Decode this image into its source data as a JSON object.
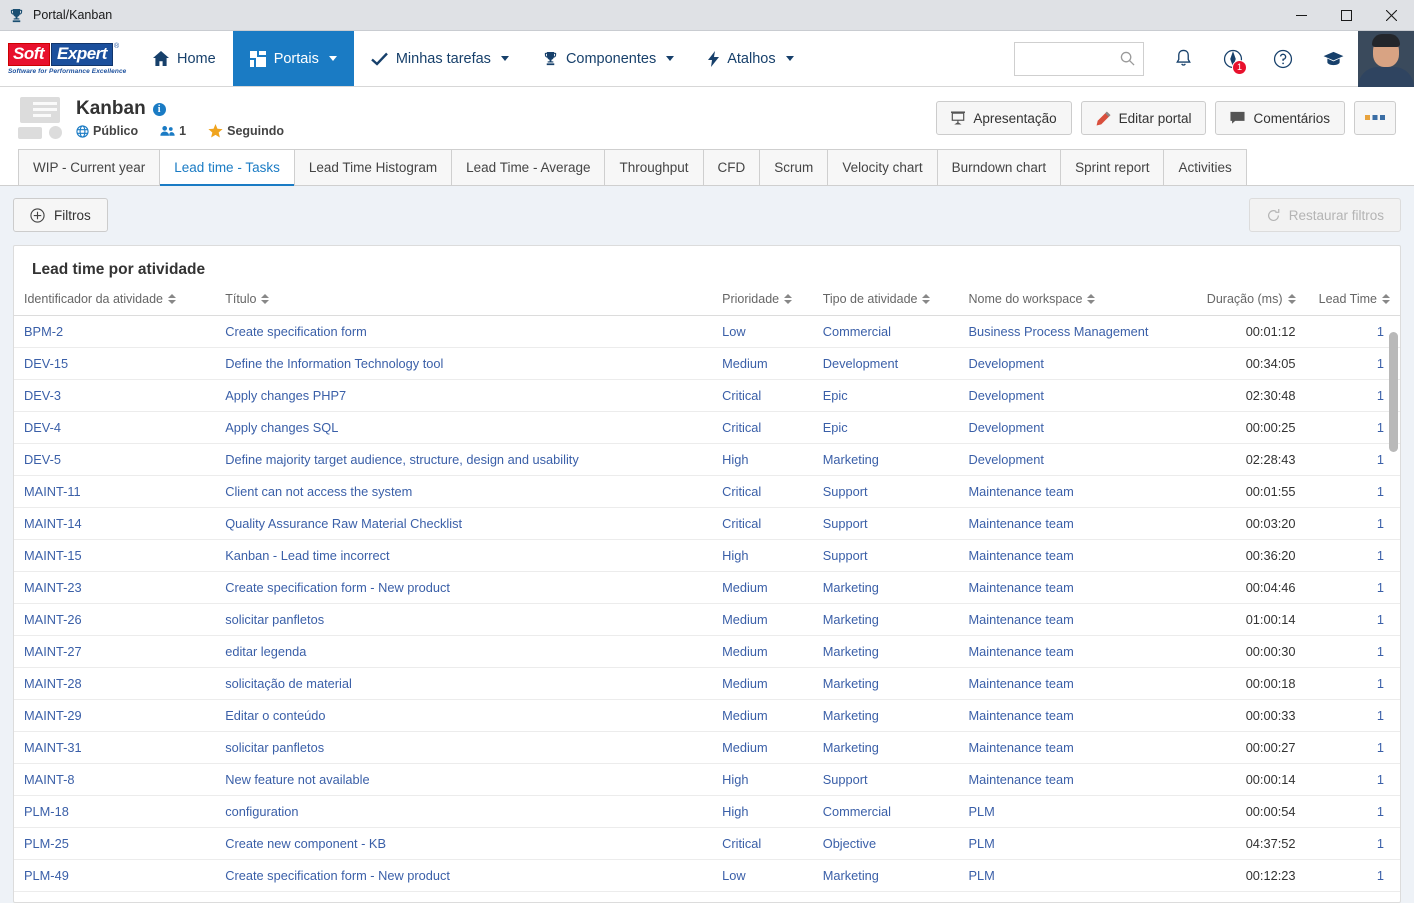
{
  "window": {
    "title": "Portal/Kanban",
    "icon": "trophy-icon",
    "minimize": "–",
    "maximize": "□",
    "close": "✕"
  },
  "brand": {
    "soft": "Soft",
    "expert": "Expert",
    "registered": "®",
    "tagline": "Software for Performance Excellence"
  },
  "nav": {
    "items": [
      {
        "label": "Home",
        "icon": "home-icon",
        "caret": false,
        "active": false
      },
      {
        "label": "Portais",
        "icon": "grid-icon",
        "caret": true,
        "active": true
      },
      {
        "label": "Minhas tarefas",
        "icon": "check-icon",
        "caret": true,
        "active": false
      },
      {
        "label": "Componentes",
        "icon": "trophy-icon",
        "caret": true,
        "active": false
      },
      {
        "label": "Atalhos",
        "icon": "bolt-icon",
        "caret": true,
        "active": false
      }
    ],
    "search": {
      "value": "",
      "placeholder": ""
    },
    "icons": [
      {
        "name": "bell-icon",
        "badge": ""
      },
      {
        "name": "compass-icon",
        "badge": "1"
      },
      {
        "name": "help-icon",
        "badge": ""
      },
      {
        "name": "graduation-icon",
        "badge": ""
      }
    ]
  },
  "header": {
    "title": "Kanban",
    "info_icon": "i",
    "visibility": "Público",
    "members_count": "1",
    "follow_label": "Seguindo",
    "buttons": [
      {
        "label": "Apresentação",
        "icon": "presentation-icon"
      },
      {
        "label": "Editar portal",
        "icon": "pencil-icon"
      },
      {
        "label": "Comentários",
        "icon": "comment-icon"
      },
      {
        "label": "···",
        "icon": "more-icon"
      }
    ]
  },
  "tabs": [
    {
      "label": "WIP - Current year",
      "active": false
    },
    {
      "label": "Lead time - Tasks",
      "active": true
    },
    {
      "label": "Lead Time Histogram",
      "active": false
    },
    {
      "label": "Lead Time - Average",
      "active": false
    },
    {
      "label": "Throughput",
      "active": false
    },
    {
      "label": "CFD",
      "active": false
    },
    {
      "label": "Scrum",
      "active": false
    },
    {
      "label": "Velocity chart",
      "active": false
    },
    {
      "label": "Burndown chart",
      "active": false
    },
    {
      "label": "Sprint report",
      "active": false
    },
    {
      "label": "Activities",
      "active": false
    }
  ],
  "filters": {
    "filters_label": "Filtros",
    "filters_icon": "plus-circle-icon",
    "restore_label": "Restaurar filtros",
    "restore_icon": "refresh-icon"
  },
  "panel": {
    "title": "Lead time por atividade",
    "columns": [
      "Identificador da atividade",
      "Título",
      "Prioridade",
      "Tipo de atividade",
      "Nome do workspace",
      "Duração (ms)",
      "Lead Time"
    ],
    "rows": [
      {
        "id": "BPM-2",
        "title": "Create specification form",
        "priority": "Low",
        "type": "Commercial",
        "workspace": "Business Process Management",
        "duration": "00:01:12",
        "lead": "1"
      },
      {
        "id": "DEV-15",
        "title": "Define the Information Technology tool",
        "priority": "Medium",
        "type": "Development",
        "workspace": "Development",
        "duration": "00:34:05",
        "lead": "1"
      },
      {
        "id": "DEV-3",
        "title": "Apply changes PHP7",
        "priority": "Critical",
        "type": "Epic",
        "workspace": "Development",
        "duration": "02:30:48",
        "lead": "1"
      },
      {
        "id": "DEV-4",
        "title": "Apply changes SQL",
        "priority": "Critical",
        "type": "Epic",
        "workspace": "Development",
        "duration": "00:00:25",
        "lead": "1"
      },
      {
        "id": "DEV-5",
        "title": "Define majority target audience, structure, design and usability",
        "priority": "High",
        "type": "Marketing",
        "workspace": "Development",
        "duration": "02:28:43",
        "lead": "1"
      },
      {
        "id": "MAINT-11",
        "title": "Client can not access the system",
        "priority": "Critical",
        "type": "Support",
        "workspace": "Maintenance team",
        "duration": "00:01:55",
        "lead": "1"
      },
      {
        "id": "MAINT-14",
        "title": "Quality Assurance Raw Material Checklist",
        "priority": "Critical",
        "type": "Support",
        "workspace": "Maintenance team",
        "duration": "00:03:20",
        "lead": "1"
      },
      {
        "id": "MAINT-15",
        "title": "Kanban - Lead time incorrect",
        "priority": "High",
        "type": "Support",
        "workspace": "Maintenance team",
        "duration": "00:36:20",
        "lead": "1"
      },
      {
        "id": "MAINT-23",
        "title": "Create specification form - New product",
        "priority": "Medium",
        "type": "Marketing",
        "workspace": "Maintenance team",
        "duration": "00:04:46",
        "lead": "1"
      },
      {
        "id": "MAINT-26",
        "title": "solicitar panfletos",
        "priority": "Medium",
        "type": "Marketing",
        "workspace": "Maintenance team",
        "duration": "01:00:14",
        "lead": "1"
      },
      {
        "id": "MAINT-27",
        "title": "editar legenda",
        "priority": "Medium",
        "type": "Marketing",
        "workspace": "Maintenance team",
        "duration": "00:00:30",
        "lead": "1"
      },
      {
        "id": "MAINT-28",
        "title": "solicitação de material",
        "priority": "Medium",
        "type": "Marketing",
        "workspace": "Maintenance team",
        "duration": "00:00:18",
        "lead": "1"
      },
      {
        "id": "MAINT-29",
        "title": "Editar o conteúdo",
        "priority": "Medium",
        "type": "Marketing",
        "workspace": "Maintenance team",
        "duration": "00:00:33",
        "lead": "1"
      },
      {
        "id": "MAINT-31",
        "title": "solicitar panfletos",
        "priority": "Medium",
        "type": "Marketing",
        "workspace": "Maintenance team",
        "duration": "00:00:27",
        "lead": "1"
      },
      {
        "id": "MAINT-8",
        "title": "New feature not available",
        "priority": "High",
        "type": "Support",
        "workspace": "Maintenance team",
        "duration": "00:00:14",
        "lead": "1"
      },
      {
        "id": "PLM-18",
        "title": "configuration",
        "priority": "High",
        "type": "Commercial",
        "workspace": "PLM",
        "duration": "00:00:54",
        "lead": "1"
      },
      {
        "id": "PLM-25",
        "title": "Create new component - KB",
        "priority": "Critical",
        "type": "Objective",
        "workspace": "PLM",
        "duration": "04:37:52",
        "lead": "1"
      },
      {
        "id": "PLM-49",
        "title": "Create specification form - New product",
        "priority": "Low",
        "type": "Marketing",
        "workspace": "PLM",
        "duration": "00:12:23",
        "lead": "1"
      }
    ]
  },
  "colors": {
    "accent": "#1a7bc4",
    "link": "#3a5fa8",
    "brand_red": "#e8112d",
    "brand_blue": "#1b4f9c",
    "star": "#f0a41e",
    "body_bg": "#eef2f7"
  }
}
